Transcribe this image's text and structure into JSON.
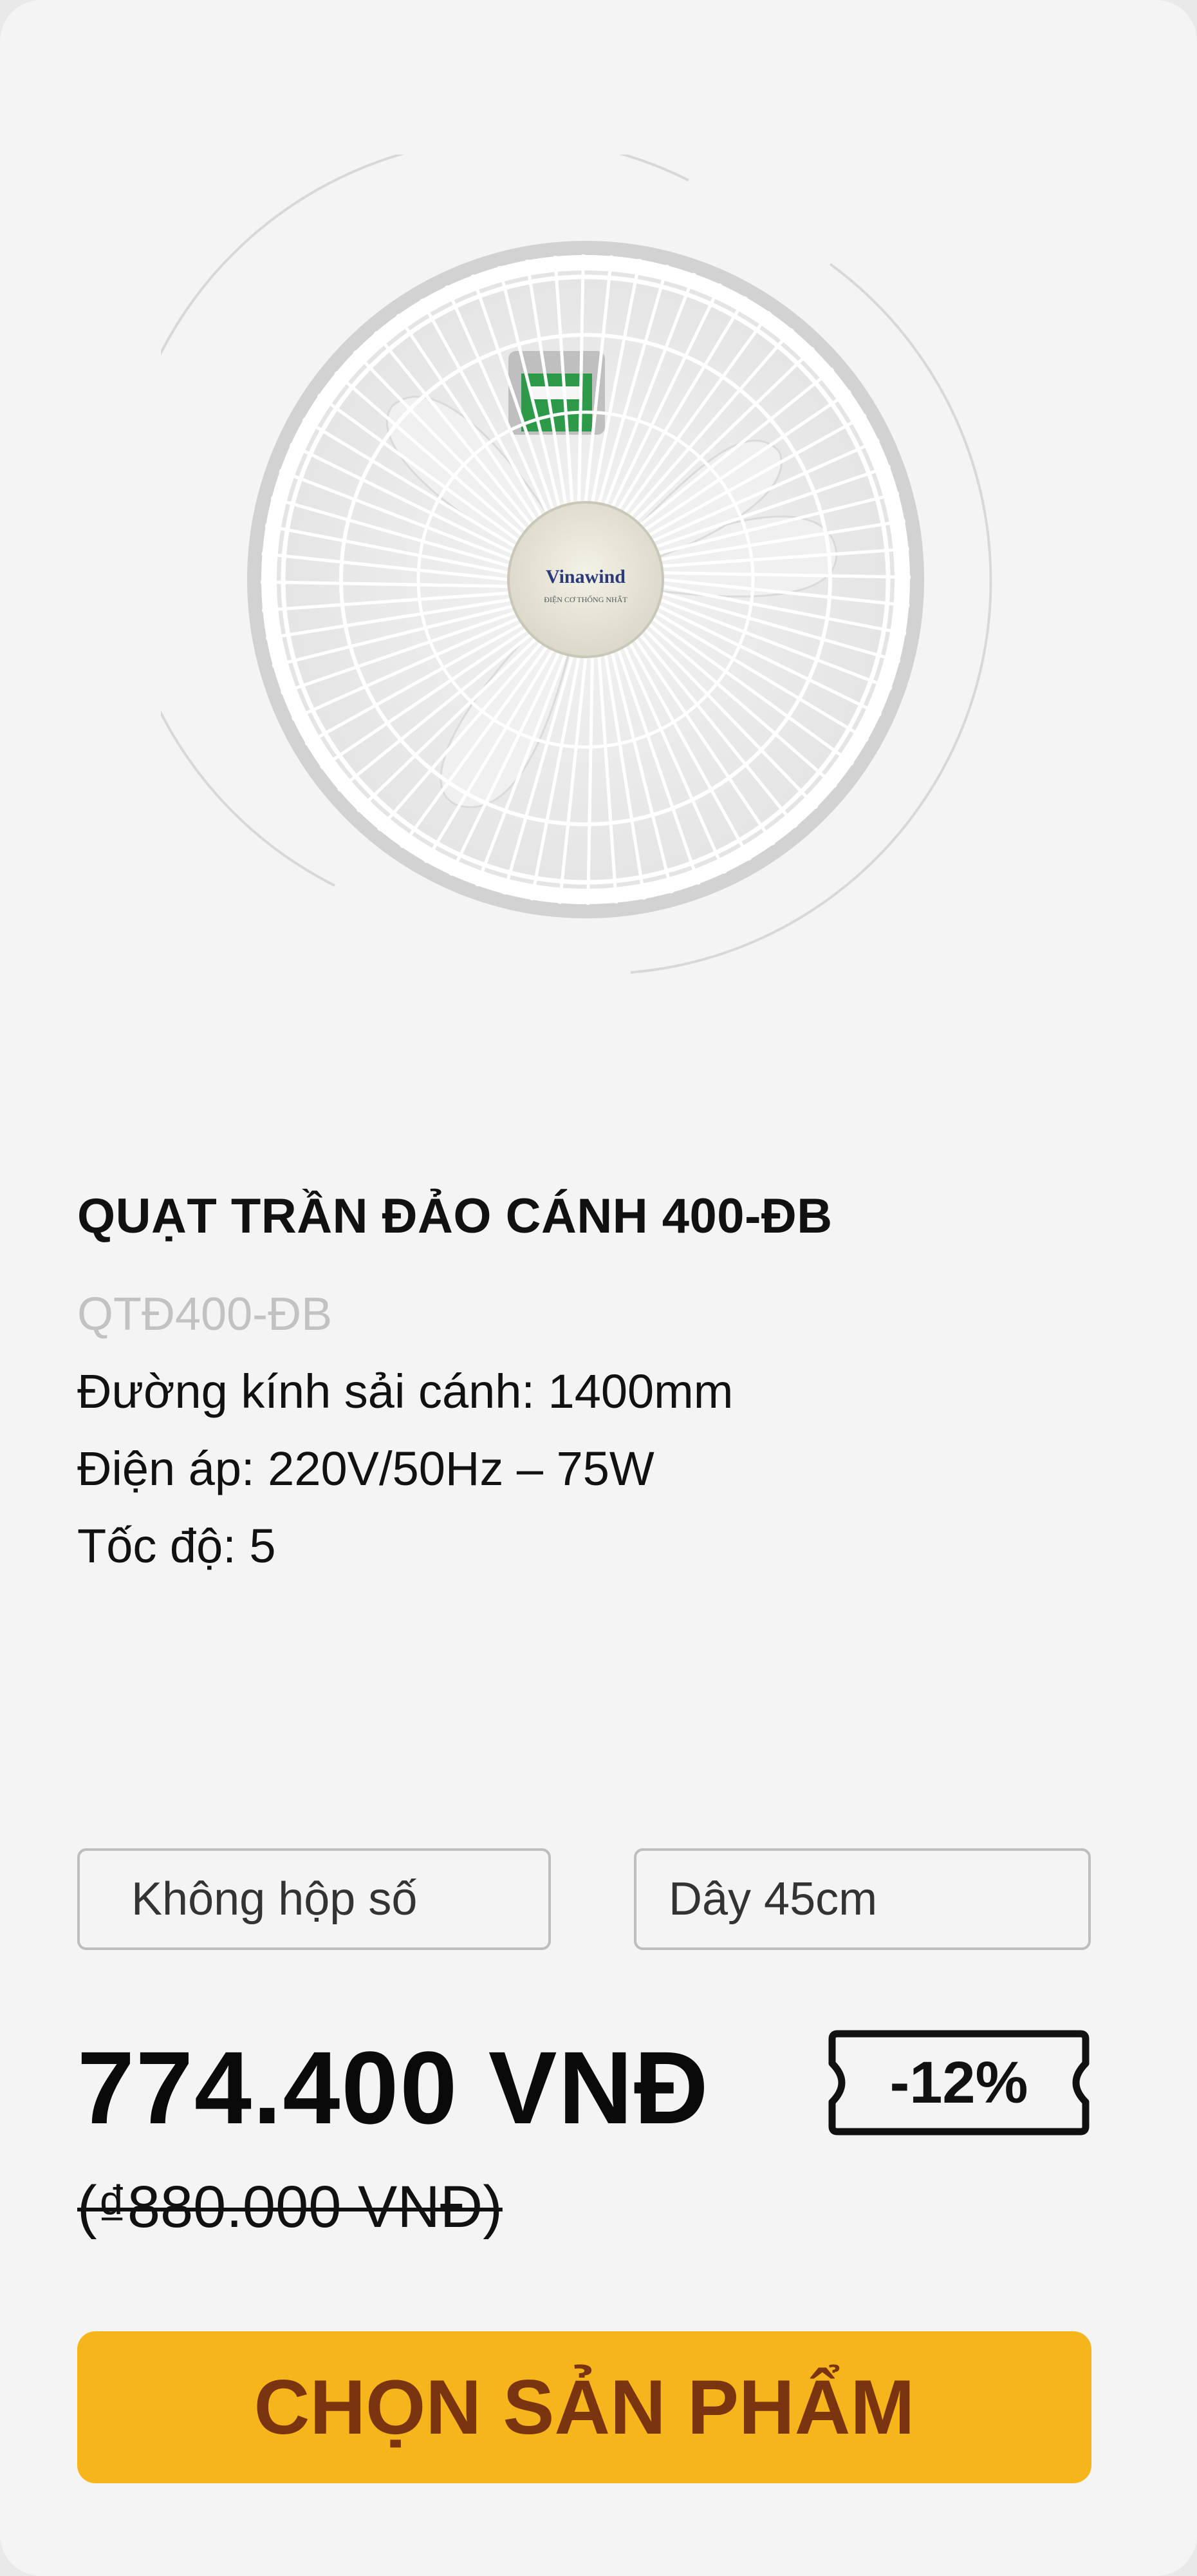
{
  "product": {
    "image_alt": "Quạt trần đảo cánh",
    "brand_on_image": "Vinawind",
    "title": "QUẠT TRẦN ĐẢO CÁNH 400-ĐB",
    "sku": "QTĐ400-ĐB",
    "specs": [
      "Đường kính sải cánh: 1400mm",
      "Điện áp: 220V/50Hz – 75W",
      "Tốc độ: 5"
    ]
  },
  "options": [
    {
      "label": "Không hộp số"
    },
    {
      "label": "Dây 45cm"
    }
  ],
  "pricing": {
    "price": "774.400 VNĐ",
    "discount": "-12%",
    "old_price": "(₫880.000 VNĐ)"
  },
  "cta": {
    "label": "CHỌN SẢN PHẨM"
  },
  "colors": {
    "card_bg": "#f4f4f4",
    "cta_bg": "#f6b51b",
    "cta_text": "#7a3410",
    "sku_text": "#c2c2c2"
  }
}
